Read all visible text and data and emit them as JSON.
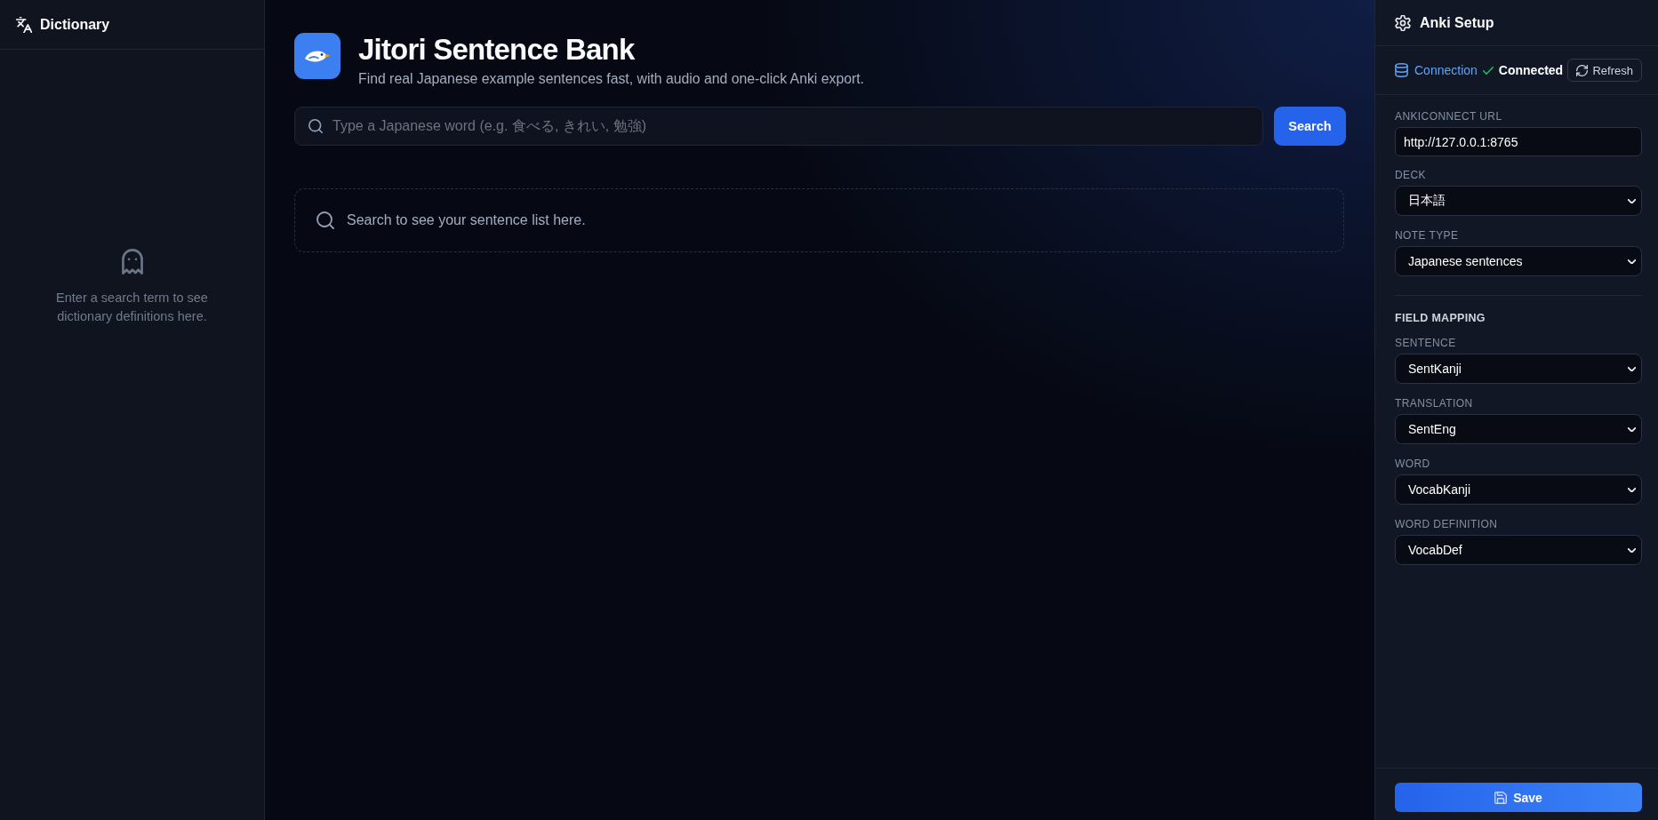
{
  "sidebar": {
    "title": "Dictionary",
    "empty_message": "Enter a search term to see dictionary definitions here."
  },
  "header": {
    "title": "Jitori Sentence Bank",
    "subtitle": "Find real Japanese example sentences fast, with audio and one-click Anki export."
  },
  "search": {
    "placeholder": "Type a Japanese word (e.g. 食べる, きれい, 勉強)",
    "button": "Search"
  },
  "results": {
    "empty_message": "Search to see your sentence list here."
  },
  "anki_setup": {
    "title": "Anki Setup",
    "connection": {
      "label": "Connection",
      "connected": true,
      "status": "Connected",
      "refresh_button": "Refresh"
    },
    "settings": [
      {
        "kind": "input",
        "label": "ANKICONNECT URL",
        "value": "http://127.0.0.1:8765"
      },
      {
        "kind": "select",
        "label": "DECK",
        "value": "日本語"
      },
      {
        "kind": "select",
        "label": "NOTE TYPE",
        "value": "Japanese sentences"
      }
    ],
    "field_mapping": {
      "title": "FIELD MAPPING",
      "fields": [
        {
          "label": "SENTENCE",
          "value": "SentKanji"
        },
        {
          "label": "TRANSLATION",
          "value": "SentEng"
        },
        {
          "label": "WORD",
          "value": "VocabKanji"
        },
        {
          "label": "WORD DEFINITION",
          "value": "VocabDef"
        }
      ]
    },
    "save_button": "Save"
  }
}
